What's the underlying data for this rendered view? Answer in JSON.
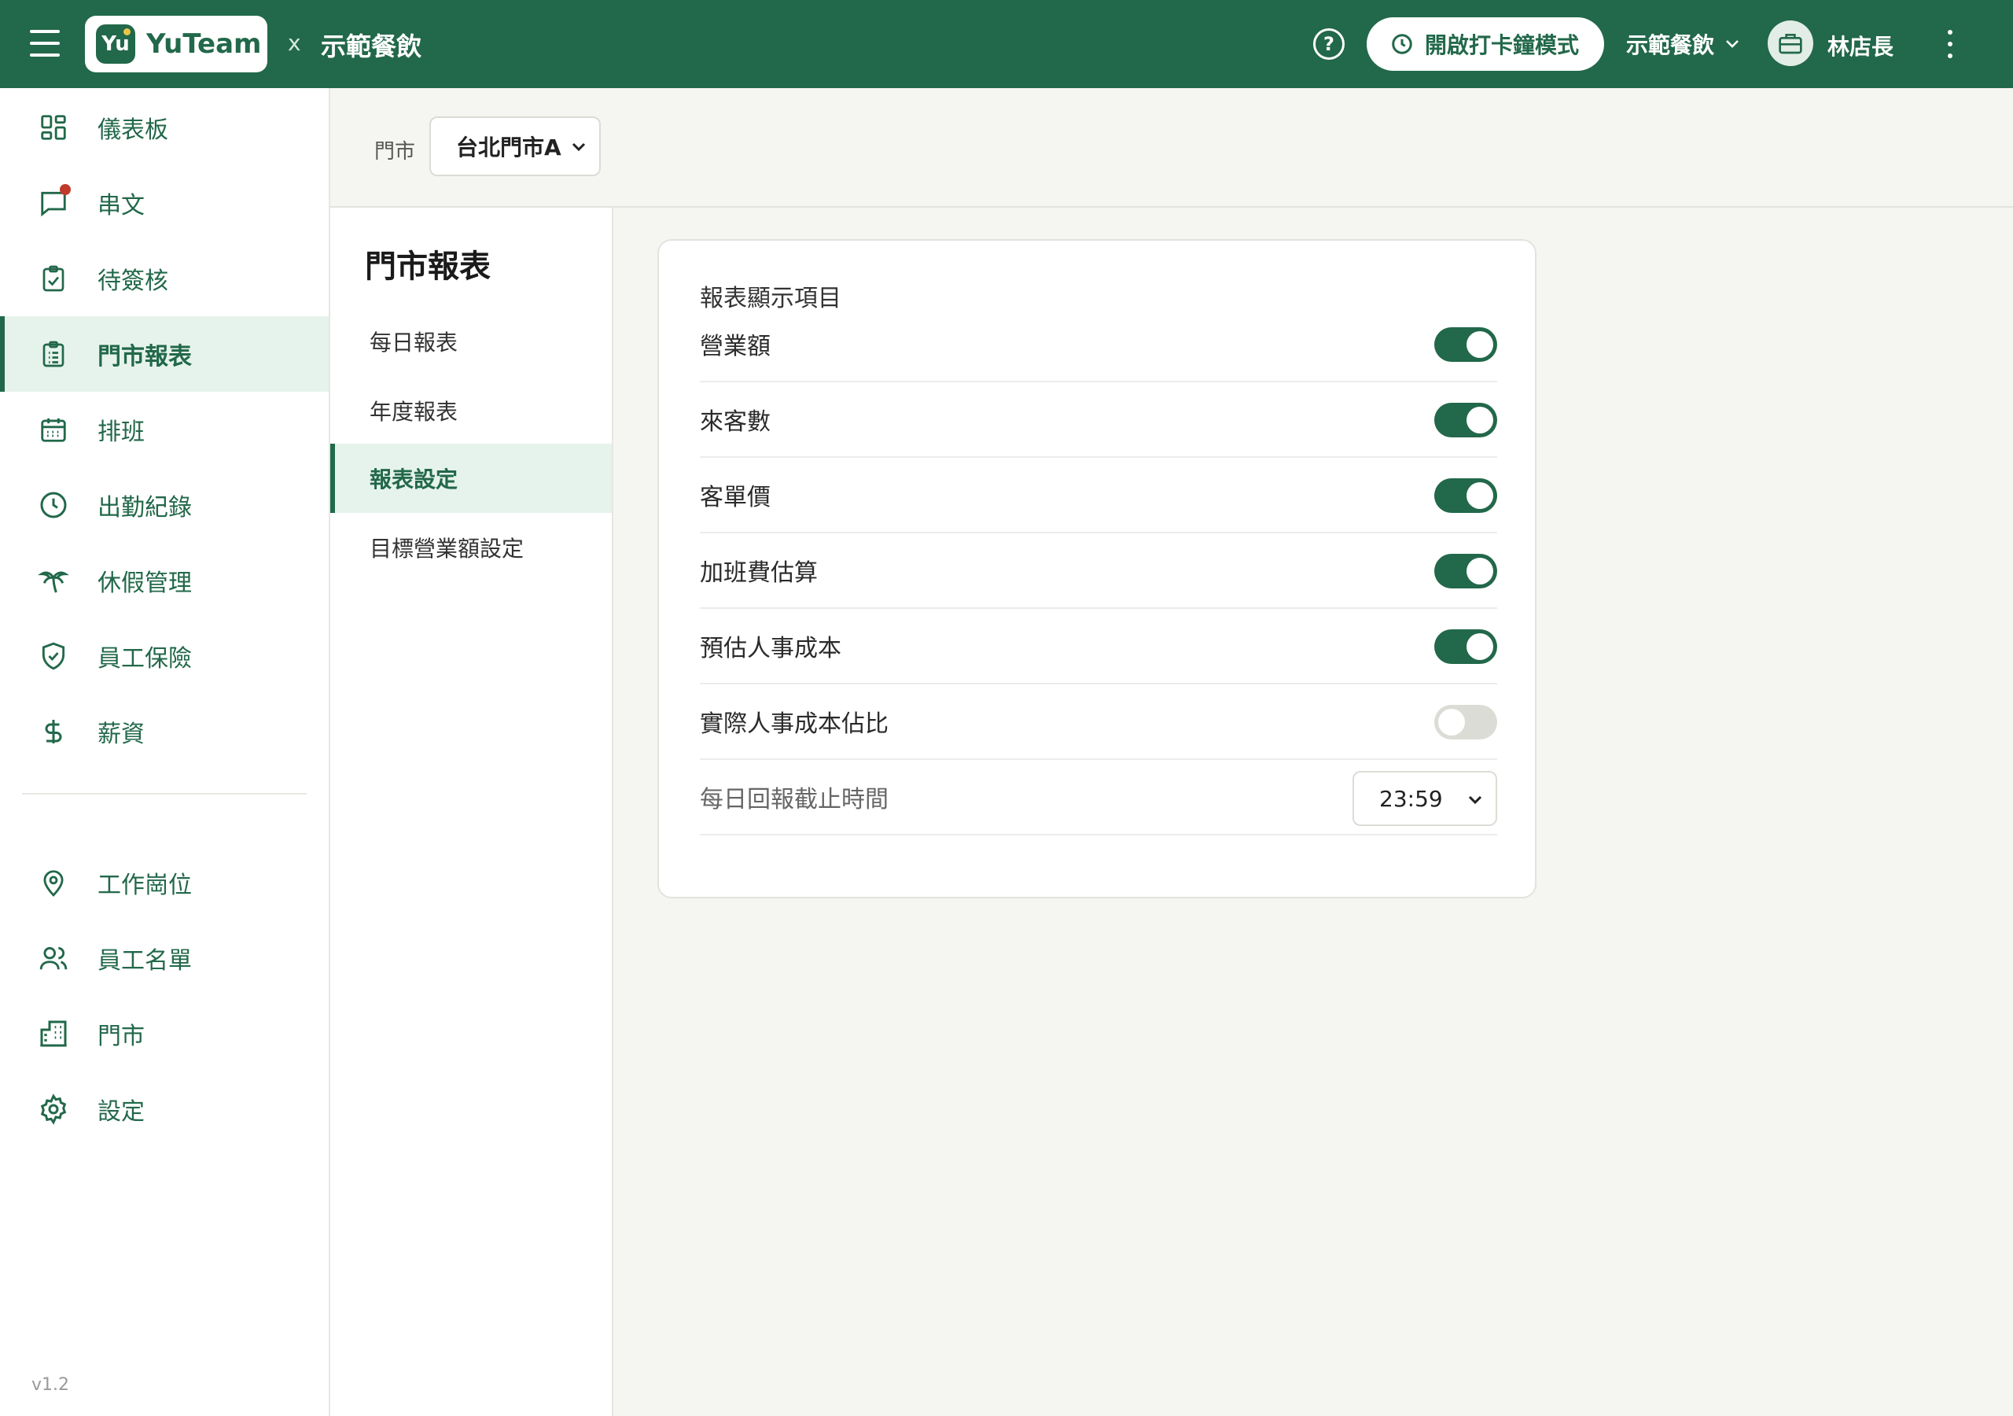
{
  "topbar": {
    "logo_mark": "Yu",
    "logo_text": "YuTeam",
    "separator": "x",
    "company": "示範餐飲",
    "clock_button": "開啟打卡鐘模式",
    "company_selector": "示範餐飲",
    "username": "林店長",
    "accent_color": "#22684a"
  },
  "sidebar": {
    "items": [
      {
        "label": "儀表板",
        "icon": "dashboard-icon"
      },
      {
        "label": "串文",
        "icon": "chat-icon"
      },
      {
        "label": "待簽核",
        "icon": "clipboard-check-icon"
      },
      {
        "label": "門市報表",
        "icon": "report-icon"
      },
      {
        "label": "排班",
        "icon": "calendar-icon"
      },
      {
        "label": "出勤紀錄",
        "icon": "clock-icon"
      },
      {
        "label": "休假管理",
        "icon": "palm-tree-icon"
      },
      {
        "label": "員工保險",
        "icon": "shield-icon"
      },
      {
        "label": "薪資",
        "icon": "dollar-icon"
      },
      {
        "label": "工作崗位",
        "icon": "location-pin-icon"
      },
      {
        "label": "員工名單",
        "icon": "users-icon"
      },
      {
        "label": "門市",
        "icon": "building-icon"
      },
      {
        "label": "設定",
        "icon": "gear-icon"
      }
    ],
    "active_item": "門市報表",
    "version": "v1.2"
  },
  "filter": {
    "label": "門市",
    "store_value": "台北門市A"
  },
  "submenu": {
    "title": "門市報表",
    "items": [
      "每日報表",
      "年度報表",
      "報表設定",
      "目標營業額設定"
    ],
    "active_item": "報表設定"
  },
  "settings": {
    "title": "報表顯示項目",
    "rows": [
      {
        "label": "營業額",
        "enabled": true
      },
      {
        "label": "來客數",
        "enabled": true
      },
      {
        "label": "客單價",
        "enabled": true
      },
      {
        "label": "加班費估算",
        "enabled": true
      },
      {
        "label": "預估人事成本",
        "enabled": true
      },
      {
        "label": "實際人事成本佔比",
        "enabled": false
      }
    ],
    "cutoff_label": "每日回報截止時間",
    "cutoff_value": "23:59"
  }
}
